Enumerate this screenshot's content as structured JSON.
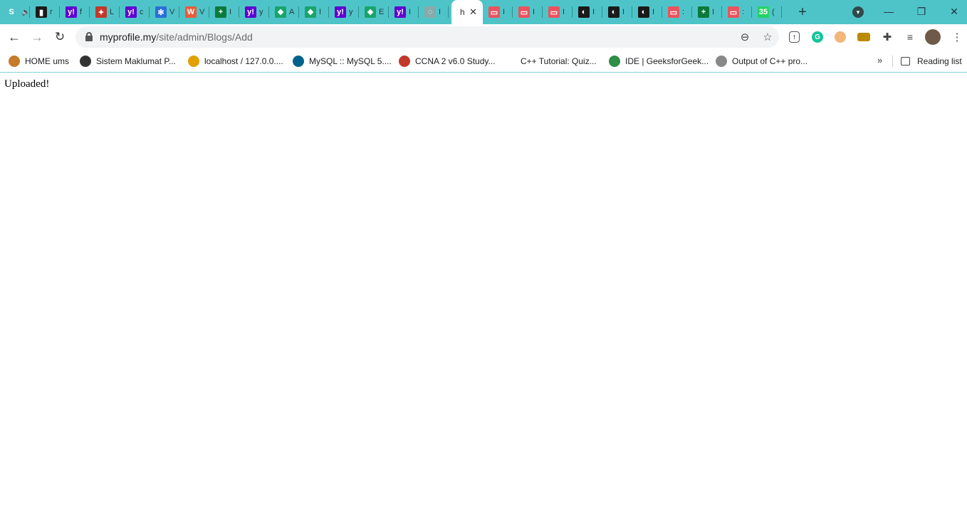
{
  "tabs": [
    {
      "letter": "S",
      "title": "S",
      "fav": "sound-icon",
      "color": "#4fc4c8"
    },
    {
      "letter": "▮",
      "title": "r",
      "fav": "trello-icon",
      "color": "#1a1a1a"
    },
    {
      "letter": "y!",
      "title": "f",
      "fav": "yahoo-icon",
      "color": "#5f01d1"
    },
    {
      "letter": "✦",
      "title": "L",
      "fav": "red-figure-icon",
      "color": "#c0392b"
    },
    {
      "letter": "y!",
      "title": "c",
      "fav": "yahoo-icon",
      "color": "#5f01d1"
    },
    {
      "letter": "✻",
      "title": "V",
      "fav": "snowflake-icon",
      "color": "#2a6fd6"
    },
    {
      "letter": "W",
      "title": "V",
      "fav": "w-icon",
      "color": "#e85c3a"
    },
    {
      "letter": "+",
      "title": "I",
      "fav": "green-cross-icon",
      "color": "#0a7a3a"
    },
    {
      "letter": "y!",
      "title": "y",
      "fav": "yahoo-icon",
      "color": "#5f01d1"
    },
    {
      "letter": "❖",
      "title": "A",
      "fav": "diamond-icon",
      "color": "#19a46b"
    },
    {
      "letter": "❖",
      "title": "I",
      "fav": "diamond-icon",
      "color": "#19a46b"
    },
    {
      "letter": "y!",
      "title": "y",
      "fav": "yahoo-icon",
      "color": "#5f01d1"
    },
    {
      "letter": "❖",
      "title": "E",
      "fav": "diamond-icon",
      "color": "#19a46b"
    },
    {
      "letter": "y!",
      "title": "I",
      "fav": "yahoo-icon",
      "color": "#5f01d1"
    },
    {
      "letter": "◌",
      "title": "I",
      "fav": "globe-icon",
      "color": "#8aa"
    },
    {
      "letter": "",
      "title": "h",
      "fav": "none",
      "color": "#ffffff",
      "active": true
    },
    {
      "letter": "▭",
      "title": "I",
      "fav": "red-window-icon",
      "color": "#e9545f"
    },
    {
      "letter": "▭",
      "title": "I",
      "fav": "red-window-icon",
      "color": "#e9545f"
    },
    {
      "letter": "▭",
      "title": "I",
      "fav": "red-window-icon",
      "color": "#e9545f"
    },
    {
      "letter": "◐",
      "title": "I",
      "fav": "globe-icon",
      "color": "#1a1a1a"
    },
    {
      "letter": "◐",
      "title": "I",
      "fav": "globe-icon",
      "color": "#1a1a1a"
    },
    {
      "letter": "◐",
      "title": "I",
      "fav": "globe-icon",
      "color": "#1a1a1a"
    },
    {
      "letter": "▭",
      "title": ":",
      "fav": "red-window-icon",
      "color": "#e9545f"
    },
    {
      "letter": "+",
      "title": "I",
      "fav": "green-cross-icon",
      "color": "#0a7a3a"
    },
    {
      "letter": "▭",
      "title": ":",
      "fav": "red-window-icon",
      "color": "#e9545f"
    },
    {
      "letter": "35",
      "title": "(",
      "fav": "whatsapp-icon",
      "color": "#25d366"
    }
  ],
  "toolbar": {
    "url_host": "myprofile.my",
    "url_path": "/site/admin/Blogs/Add"
  },
  "bookmarks": [
    {
      "label": "HOME ums",
      "icon": "crest-icon",
      "color": "#c47b2a"
    },
    {
      "label": "Sistem Maklumat P...",
      "icon": "globe-icon",
      "color": "#333333"
    },
    {
      "label": "localhost / 127.0.0....",
      "icon": "pma-icon",
      "color": "#e0a000"
    },
    {
      "label": "MySQL :: MySQL 5....",
      "icon": "mysql-icon",
      "color": "#00618a"
    },
    {
      "label": "CCNA 2 v6.0 Study...",
      "icon": "cisco-icon",
      "color": "#c0392b"
    },
    {
      "label": "C++ Tutorial: Quiz...",
      "icon": "blank-icon",
      "color": "#ffffff"
    },
    {
      "label": "IDE | GeeksforGeek...",
      "icon": "gfg-icon",
      "color": "#2f8d46"
    },
    {
      "label": "Output of C++ pro...",
      "icon": "gfg-box-icon",
      "color": "#888888"
    }
  ],
  "reading_list_label": "Reading list",
  "page": {
    "message": "Uploaded!"
  }
}
